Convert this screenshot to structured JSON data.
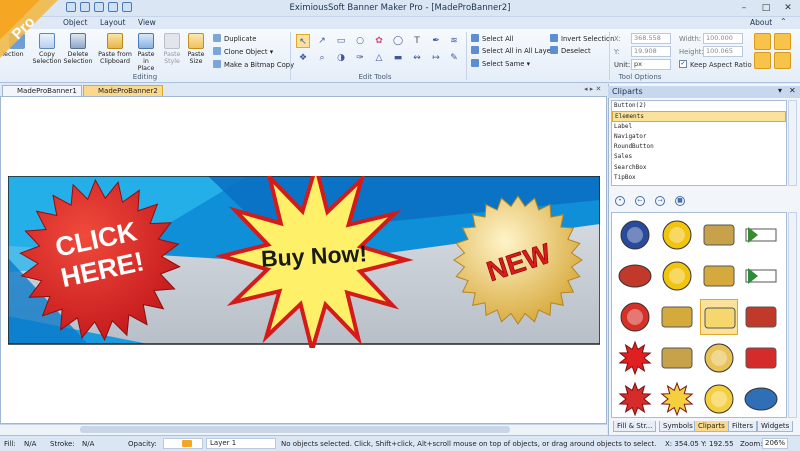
{
  "app": {
    "title": "EximiousSoft Banner Maker Pro - [MadeProBanner2]",
    "pro_badge": "Pro",
    "about": "About",
    "accent_orange": "#f5a623",
    "ribbon_blue": "#dfe9f5"
  },
  "menu": [
    "Object",
    "Layout",
    "View"
  ],
  "ribbon": {
    "edit_buttons": [
      {
        "label": "Copy Selection",
        "icon": "copy-icon"
      },
      {
        "label": "Delete Selection",
        "icon": "delete-icon"
      },
      {
        "label": "Paste from Clipboard",
        "icon": "paste-clipboard-icon"
      },
      {
        "label": "Paste in Place",
        "icon": "paste-place-icon"
      },
      {
        "label": "Paste Style",
        "icon": "paste-style-icon"
      },
      {
        "label": "Paste Size",
        "icon": "paste-size-icon"
      }
    ],
    "edit_small": [
      "Duplicate",
      "Clone Object",
      "Make a Bitmap Copy"
    ],
    "edit_group": "Editing",
    "edit_tools_group": "Edit Tools",
    "select_items": [
      "Select All",
      "Select All in All Layers",
      "Select Same",
      "Invert Selection",
      "Deselect"
    ],
    "tool_options": {
      "x_label": "X:",
      "x_value": "368.558",
      "y_label": "Y:",
      "y_value": "19.908",
      "width_label": "Width:",
      "width_value": "100.000",
      "height_label": "Height:",
      "height_value": "100.065",
      "unit_label": "Unit:",
      "unit_value": "px",
      "keep_aspect": "Keep Aspect Ratio",
      "group": "Tool Options"
    }
  },
  "tabs": [
    "MadeProBanner1",
    "MadeProBanner2"
  ],
  "banner": {
    "click_text_1": "CLICK",
    "click_text_2": "HERE!",
    "buy_text": "Buy Now!",
    "new_text": "NEW"
  },
  "cliparts": {
    "title": "Cliparts",
    "list": [
      "Button(2)",
      "Elements",
      "Label",
      "Navigator",
      "RoundButton",
      "Sales",
      "SearchBox",
      "TipBox"
    ],
    "selected_index": 1,
    "bottom_tabs": [
      "Fill & Str...",
      "Symbols",
      "Cliparts",
      "Filters",
      "Widgets"
    ],
    "thumbs": [
      {
        "name": "badge-clipart",
        "color": "#2a4b9c"
      },
      {
        "name": "star-seal-clipart",
        "color": "#f1c40f"
      },
      {
        "name": "gold-label-clipart",
        "color": "#c8a14b"
      },
      {
        "name": "download-arrow-clipart",
        "color": "#3a8a2f"
      },
      {
        "name": "red-oval-clipart",
        "color": "#c0392b"
      },
      {
        "name": "yellow-ring-clipart",
        "color": "#f1c40f"
      },
      {
        "name": "gold-bubble-clipart",
        "color": "#d4aa3c"
      },
      {
        "name": "green-arrow-clipart",
        "color": "#2e8b3a"
      },
      {
        "name": "number-two-clipart",
        "color": "#d63027"
      },
      {
        "name": "ribbon-four-clipart",
        "color": "#d4aa3c"
      },
      {
        "name": "new-badge-clipart",
        "color": "#f5d76e"
      },
      {
        "name": "order-now-clipart",
        "color": "#c0392b"
      },
      {
        "name": "red-star-clipart",
        "color": "#e02020"
      },
      {
        "name": "gold-ribbon-clipart",
        "color": "#c8a14b"
      },
      {
        "name": "gold-star-burst-clipart",
        "color": "#e8c35a"
      },
      {
        "name": "red-box-clipart",
        "color": "#d62b2b"
      },
      {
        "name": "buy-now-clipart",
        "color": "#d62b2b"
      },
      {
        "name": "yellow-burst-clipart",
        "color": "#f4d03f"
      },
      {
        "name": "free-software-clipart",
        "color": "#f4d03f"
      },
      {
        "name": "blue-sphere-clipart",
        "color": "#2f6fb5"
      }
    ]
  },
  "status": {
    "fill_label": "Fill:",
    "fill_value": "N/A",
    "stroke_label": "Stroke:",
    "stroke_value": "N/A",
    "opacity_label": "Opacity:",
    "layer": "Layer 1",
    "message": "No objects selected. Click, Shift+click, Alt+scroll mouse on top of objects, or drag around objects to select.",
    "coords": "X: 354.05 Y: 192.55",
    "zoom_label": "Zoom:",
    "zoom_value": "206%"
  }
}
